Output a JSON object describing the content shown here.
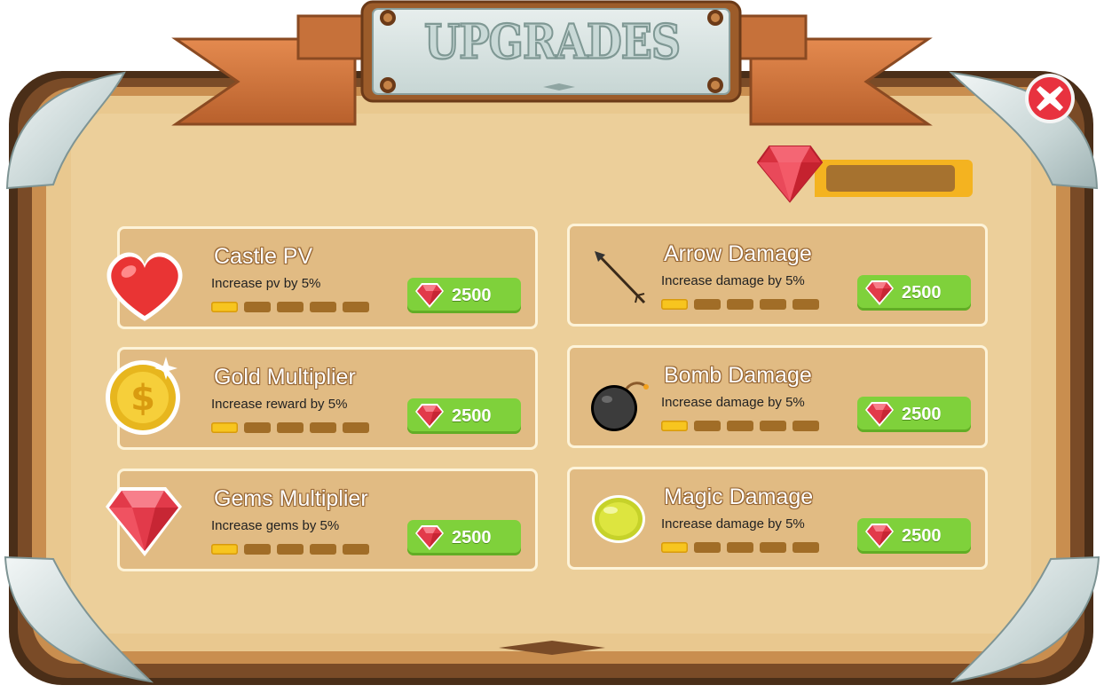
{
  "header": {
    "title": "UPGRADES"
  },
  "close_button": {
    "icon": "close-icon"
  },
  "currency": {
    "icon": "gem-icon",
    "value": ""
  },
  "colors": {
    "board": "#e9c88f",
    "frame": "#5c3b21",
    "card": "#e1bb83",
    "buy_button": "#7fd13b",
    "level_on": "#f7c51f",
    "level_off": "#a16d27",
    "close_button": "#e8323f"
  },
  "upgrades": [
    {
      "title": "Castle PV",
      "description": "Increase pv by 5%",
      "price": "2500",
      "level": 1,
      "max_level": 5,
      "icon": "heart-icon"
    },
    {
      "title": "Arrow Damage",
      "description": "Increase damage by 5%",
      "price": "2500",
      "level": 1,
      "max_level": 5,
      "icon": "arrow-icon"
    },
    {
      "title": "Gold Multiplier",
      "description": "Increase reward by 5%",
      "price": "2500",
      "level": 1,
      "max_level": 5,
      "icon": "gold-coin-icon"
    },
    {
      "title": "Bomb Damage",
      "description": "Increase damage by 5%",
      "price": "2500",
      "level": 1,
      "max_level": 5,
      "icon": "bomb-icon"
    },
    {
      "title": "Gems Multiplier",
      "description": "Increase gems by 5%",
      "price": "2500",
      "level": 1,
      "max_level": 5,
      "icon": "gem-icon"
    },
    {
      "title": "Magic Damage",
      "description": "Increase damage by 5%",
      "price": "2500",
      "level": 1,
      "max_level": 5,
      "icon": "magic-orb-icon"
    }
  ]
}
